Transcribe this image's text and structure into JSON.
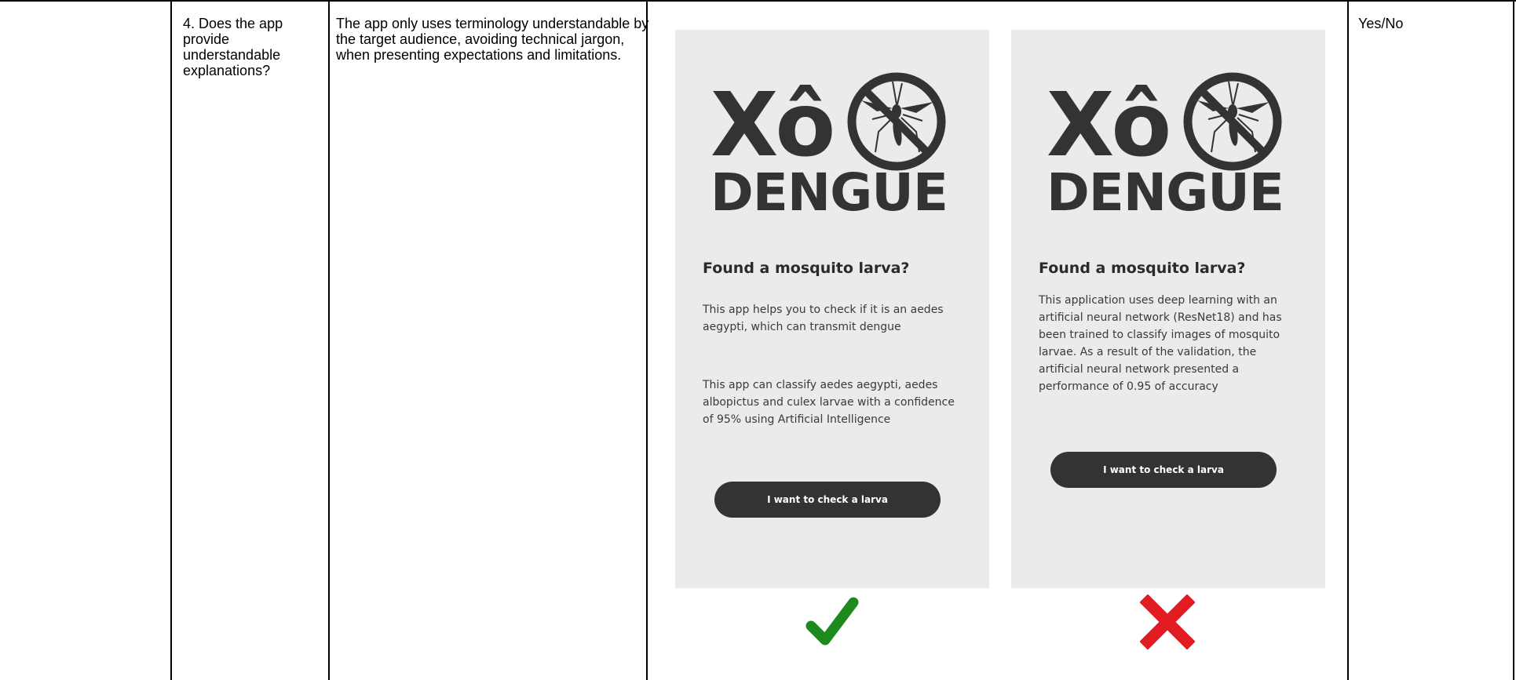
{
  "table": {
    "question": "4. Does the app provide understandable explanations?",
    "criterion": "The app only uses terminology understandable by the target audience, avoiding technical jargon, when presenting expectations and limitations.",
    "response": "Yes/No"
  },
  "mockups": [
    {
      "logo_line1": "Xô",
      "logo_line2": "DENGUE",
      "heading": "Found a mosquito larva?",
      "paragraph1": "This app helps you to check if it is an aedes aegypti, which can transmit dengue",
      "paragraph2": "This app can classify aedes aegypti, aedes albopictus and culex larvae with a confidence of 95% using Artificial Intelligence",
      "button": "I want to check a larva",
      "verdict": "correct",
      "verdict_icon": "checkmark-icon",
      "verdict_color": "#1e8a1e"
    },
    {
      "logo_line1": "Xô",
      "logo_line2": "DENGUE",
      "heading": "Found a mosquito larva?",
      "paragraph1": "This application uses deep learning with an artificial neural network (ResNet18) and has been trained to classify images of mosquito larvae. As a result of the validation, the artificial neural network presented a performance of 0.95 of accuracy",
      "button": "I want to check a larva",
      "verdict": "incorrect",
      "verdict_icon": "cross-icon",
      "verdict_color": "#e01b22"
    }
  ],
  "colors": {
    "phone_background": "#ebebeb",
    "logo_dark": "#333333",
    "button_background": "#333333"
  }
}
